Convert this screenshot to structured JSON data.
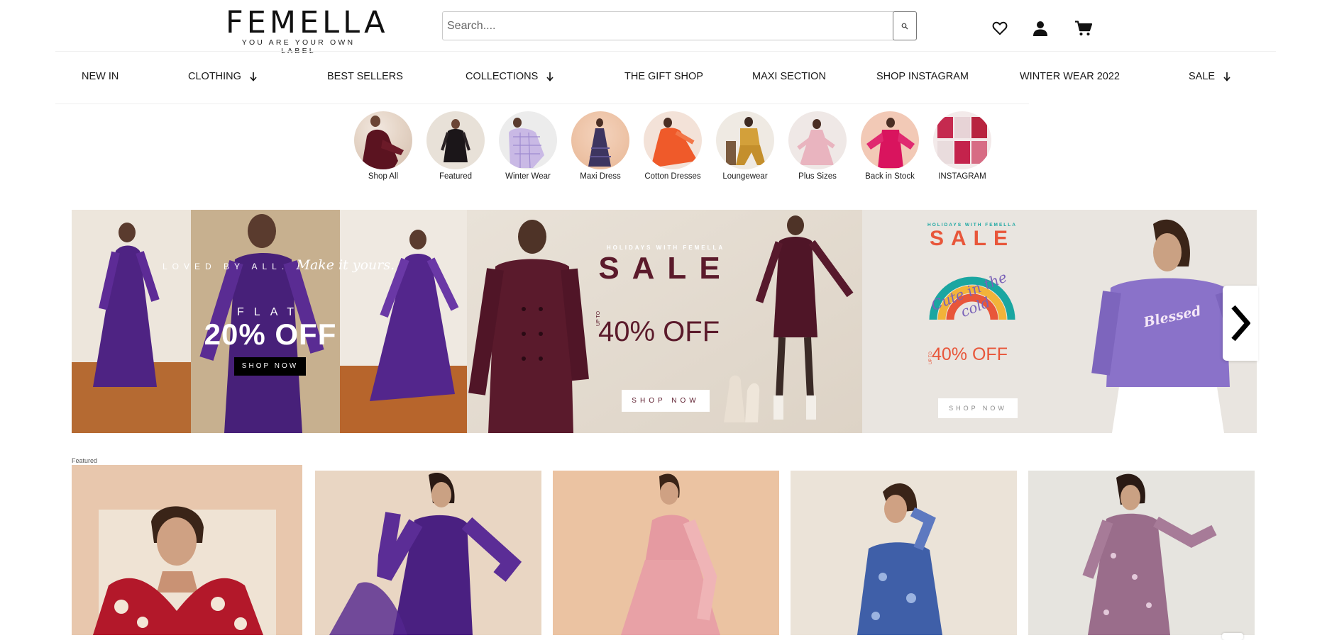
{
  "header": {
    "logo_text": "FEMELLA",
    "tagline": "YOU ARE YOUR OWN LABEL",
    "search_placeholder": "Search....",
    "icons": [
      "heart-icon",
      "user-icon",
      "cart-icon",
      "search-icon"
    ]
  },
  "nav": {
    "items": [
      {
        "label": "NEW IN",
        "has_arrow": false
      },
      {
        "label": "CLOTHING",
        "has_arrow": true
      },
      {
        "label": "BEST SELLERS",
        "has_arrow": false
      },
      {
        "label": "COLLECTIONS",
        "has_arrow": true
      },
      {
        "label": "THE GIFT SHOP",
        "has_arrow": false
      },
      {
        "label": "MAXI SECTION",
        "has_arrow": false
      },
      {
        "label": "SHOP INSTAGRAM",
        "has_arrow": false
      },
      {
        "label": "WINTER WEAR 2022",
        "has_arrow": false
      },
      {
        "label": "SALE",
        "has_arrow": true
      }
    ]
  },
  "categories": [
    {
      "label": "Shop All"
    },
    {
      "label": "Featured"
    },
    {
      "label": "Winter Wear"
    },
    {
      "label": "Maxi Dress"
    },
    {
      "label": "Cotton Dresses"
    },
    {
      "label": "Loungewear"
    },
    {
      "label": "Plus Sizes"
    },
    {
      "label": "Back in Stock"
    },
    {
      "label": "INSTAGRAM"
    }
  ],
  "banner": {
    "panel1": {
      "tagline_caps": "LOVED BY ALL.",
      "tagline_script": "Make it yours.",
      "flat": "FLAT",
      "offer": "20% OFF",
      "cta": "SHOP NOW"
    },
    "panel2": {
      "eyebrow": "HOLIDAYS WITH FEMELLA",
      "headline": "SALE",
      "upto": "UP TO",
      "offer": "40% OFF",
      "cta": "SHOP NOW"
    },
    "panel3": {
      "eyebrow": "HOLIDAYS WITH FEMELLA",
      "headline": "SALE",
      "script": "Cute in the cold",
      "upto": "UP TO",
      "offer": "40% OFF",
      "cta": "SHOP NOW",
      "hoodie_text": "Blessed"
    }
  },
  "featured": {
    "label": "Featured"
  },
  "colors": {
    "panel1_bg": "#b98c5f",
    "dress_purple": "#5a2d8a",
    "panel2_bg": "#ebe5dc",
    "maroon": "#5b1a2b",
    "panel3_bg": "#e9e5e1",
    "hoodie": "#8a72c9",
    "sale_red": "#e8563a"
  }
}
